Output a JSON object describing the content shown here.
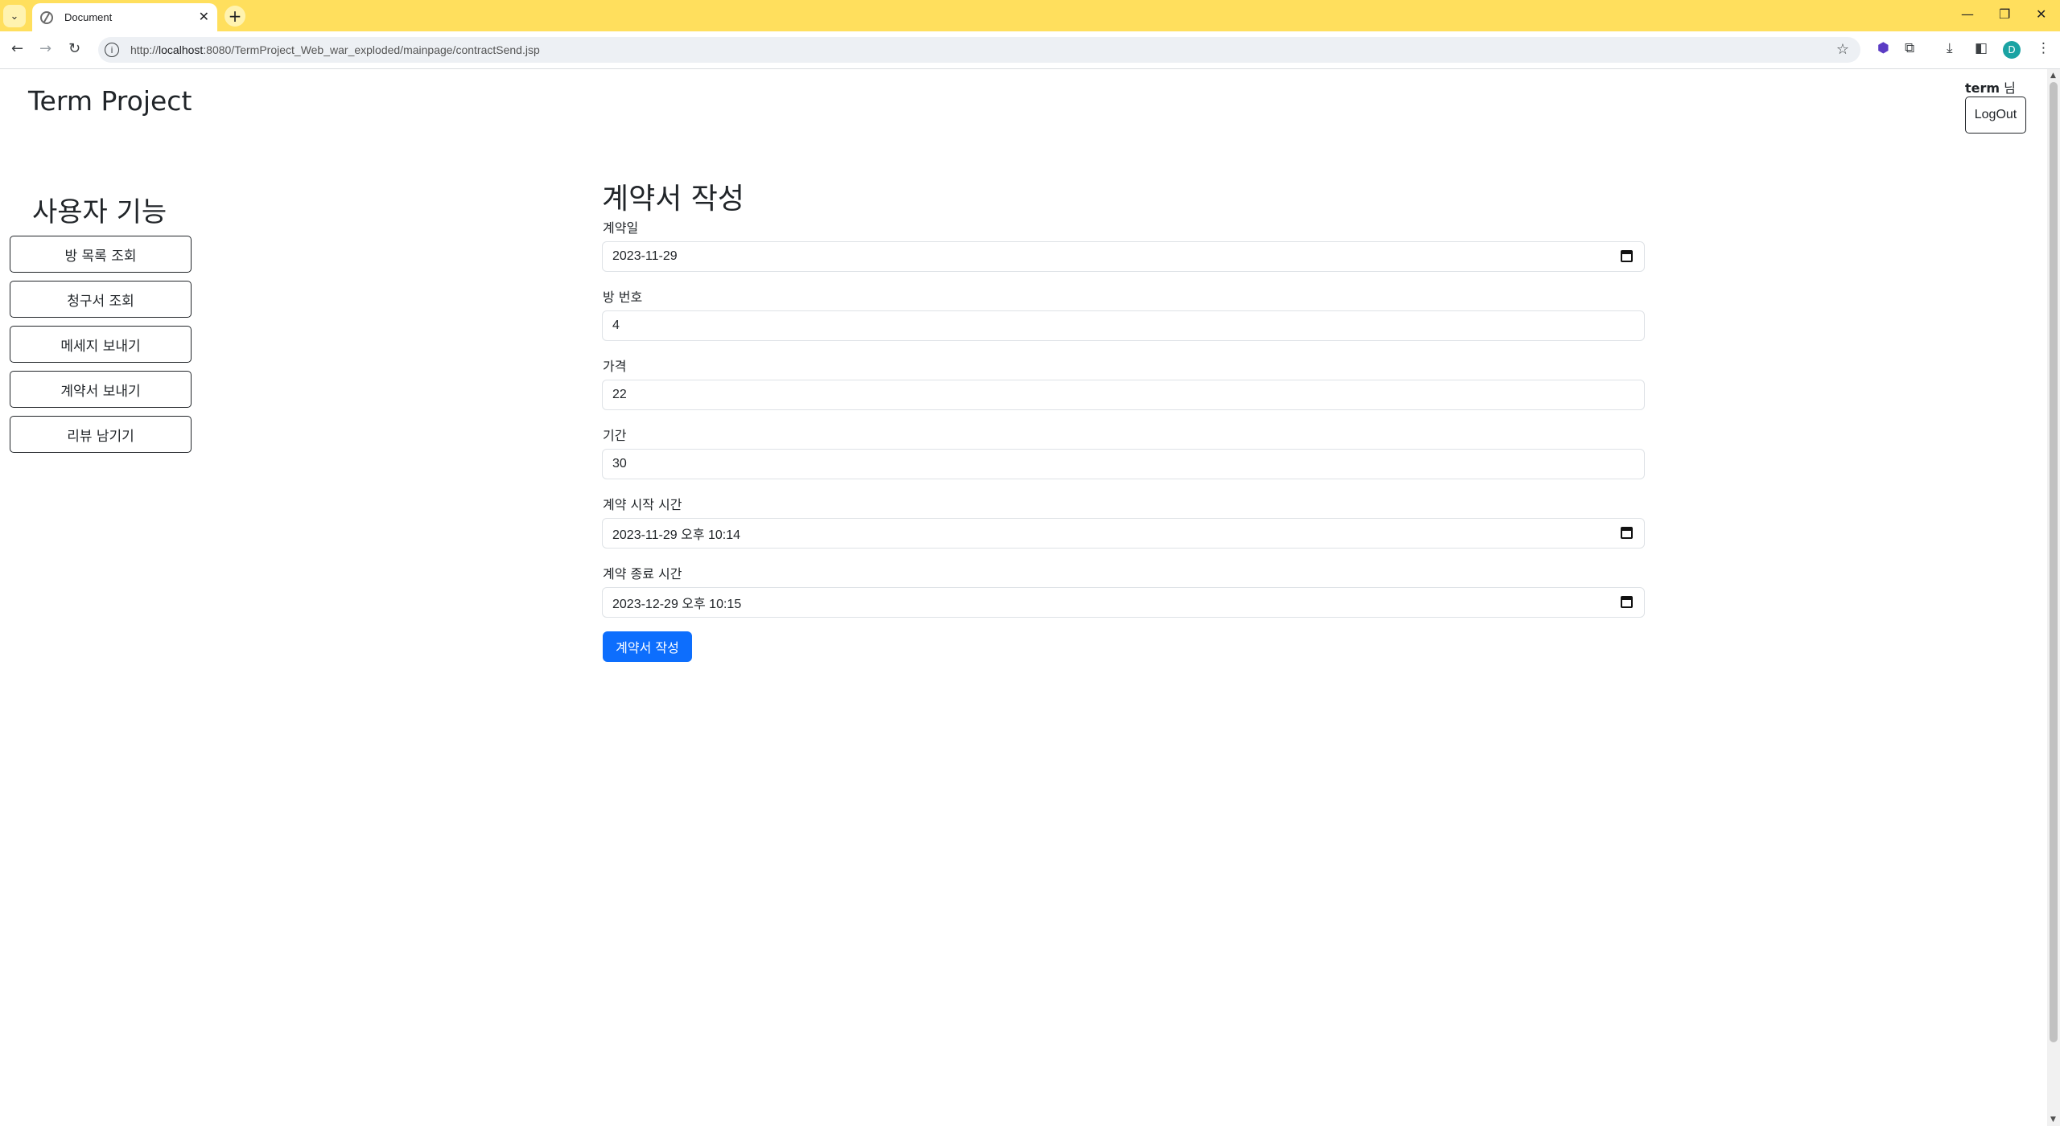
{
  "browser": {
    "tab_title": "Document",
    "url_prefix": "http://",
    "url_host": "localhost",
    "url_rest": ":8080/TermProject_Web_war_exploded/mainpage/contractSend.jsp",
    "profile_initial": "D",
    "accent_color": "#ffdf5d"
  },
  "header": {
    "brand": "Term Project",
    "username": "term",
    "greeting_suffix": "님",
    "logout_label": "LogOut"
  },
  "sidebar": {
    "title": "사용자 기능",
    "items": [
      {
        "label": "방 목록 조회"
      },
      {
        "label": "청구서 조회"
      },
      {
        "label": "메세지 보내기"
      },
      {
        "label": "계약서 보내기"
      },
      {
        "label": "리뷰 남기기"
      }
    ]
  },
  "form": {
    "title": "계약서 작성",
    "fields": [
      {
        "label": "계약일",
        "value": "2023-11-29",
        "type": "date"
      },
      {
        "label": "방 번호",
        "value": "4",
        "type": "text"
      },
      {
        "label": "가격",
        "value": "22",
        "type": "text"
      },
      {
        "label": "기간",
        "value": "30",
        "type": "text"
      },
      {
        "label": "계약 시작 시간",
        "value": "2023-11-29 오후 10:14",
        "type": "datetime"
      },
      {
        "label": "계약 종료 시간",
        "value": "2023-12-29 오후 10:15",
        "type": "datetime"
      }
    ],
    "submit_label": "계약서 작성",
    "submit_color": "#0d6efd"
  }
}
